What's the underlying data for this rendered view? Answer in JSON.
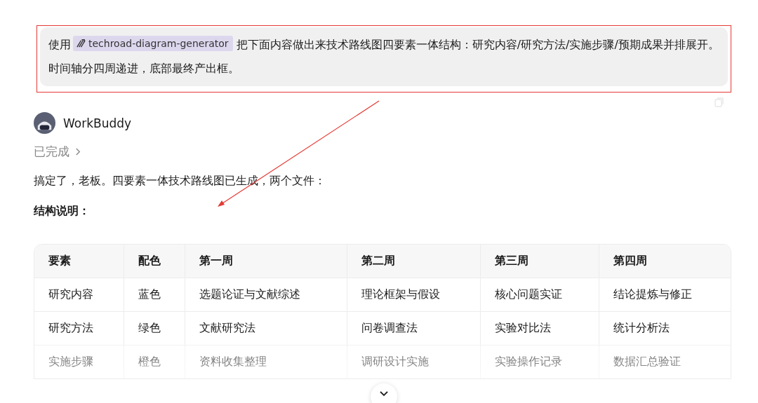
{
  "prompt": {
    "before": "使用",
    "skill": "techroad-diagram-generator",
    "after": "把下面内容做出来技术路线图四要素一体结构：研究内容/研究方法/实施步骤/预期成果并排展开。时间轴分四周递进，底部最终产出框。"
  },
  "reply": {
    "agent": "WorkBuddy",
    "status": "已完成",
    "message": "搞定了，老板。四要素一体技术路线图已生成，两个文件：",
    "heading": "结构说明："
  },
  "table": {
    "columns": [
      "要素",
      "配色",
      "第一周",
      "第二周",
      "第三周",
      "第四周"
    ],
    "rows": [
      [
        "研究内容",
        "蓝色",
        "选题论证与文献综述",
        "理论框架与假设",
        "核心问题实证",
        "结论提炼与修正"
      ],
      [
        "研究方法",
        "绿色",
        "文献研究法",
        "问卷调查法",
        "实验对比法",
        "统计分析法"
      ],
      [
        "实施步骤",
        "橙色",
        "资料收集整理",
        "调研设计实施",
        "实验操作记录",
        "数据汇总验证"
      ]
    ]
  }
}
